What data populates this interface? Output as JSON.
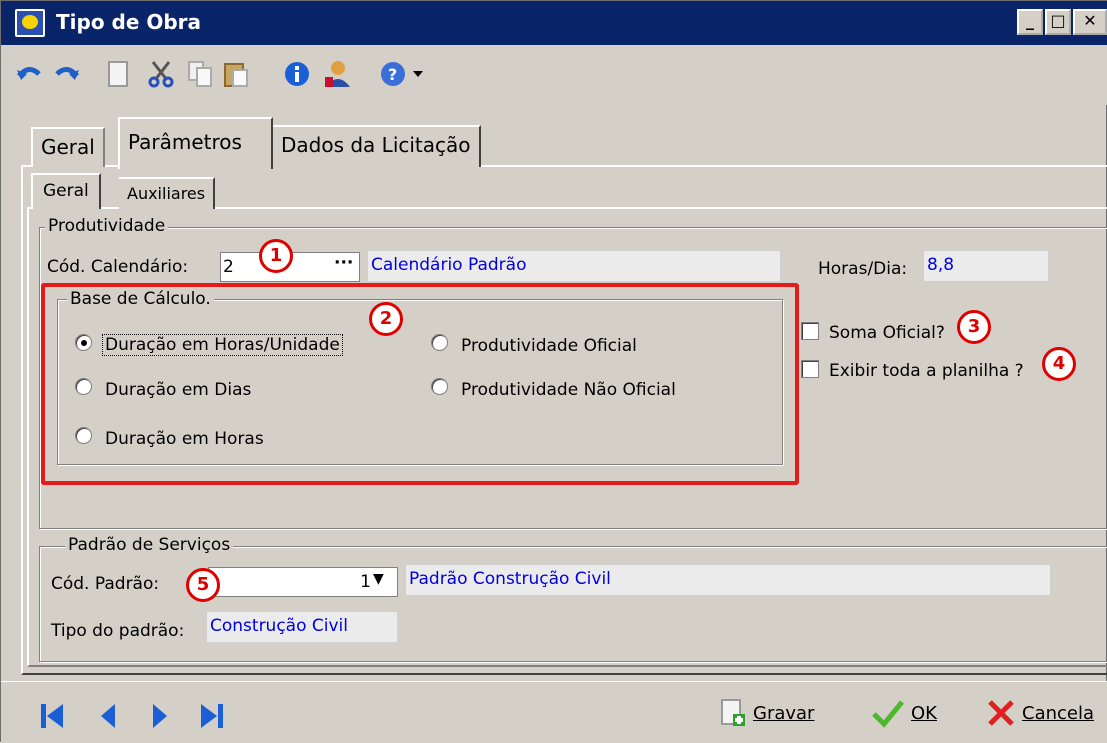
{
  "window": {
    "title": "Tipo de Obra"
  },
  "tabs": [
    {
      "label": "Geral"
    },
    {
      "label": "Parâmetros"
    },
    {
      "label": "Dados da Licitação"
    }
  ],
  "subtabs": [
    {
      "label": "Geral"
    },
    {
      "label": "Auxiliares"
    }
  ],
  "produtividade": {
    "group_title": "Produtividade",
    "cod_calendario_label": "Cód. Calendário:",
    "cod_calendario_value": "2",
    "lookup_button": "···",
    "calendario_desc": "Calendário Padrão",
    "horas_dia_label": "Horas/Dia:",
    "horas_dia_value": "8,8",
    "soma_oficial_label": "Soma Oficial?",
    "exibir_planilha_label": "Exibir toda a planilha ?"
  },
  "base_calculo": {
    "group_title": "Base de Cálculo.",
    "options": [
      {
        "label": "Duração em Horas/Unidade",
        "selected": true
      },
      {
        "label": "Duração em Dias",
        "selected": false
      },
      {
        "label": "Duração em Horas",
        "selected": false
      },
      {
        "label": "Produtividade Oficial",
        "selected": false
      },
      {
        "label": "Produtividade Não Oficial",
        "selected": false
      }
    ]
  },
  "padrao_servicos": {
    "group_title": "Padrão de Serviços",
    "cod_padrao_label": "Cód. Padrão:",
    "cod_padrao_value": "1",
    "padrao_desc": "Padrão Construção Civil",
    "tipo_padrao_label": "Tipo do padrão:",
    "tipo_padrao_value": "Construção Civil"
  },
  "annotations": [
    "1",
    "2",
    "3",
    "4",
    "5"
  ],
  "actions": {
    "gravar": "Gravar",
    "ok": "OK",
    "cancela": "Cancela"
  },
  "colors": {
    "titlebar": "#0a246a",
    "face": "#d4d0c8",
    "link_text": "#0000e0",
    "annotation_red": "#e00000"
  }
}
